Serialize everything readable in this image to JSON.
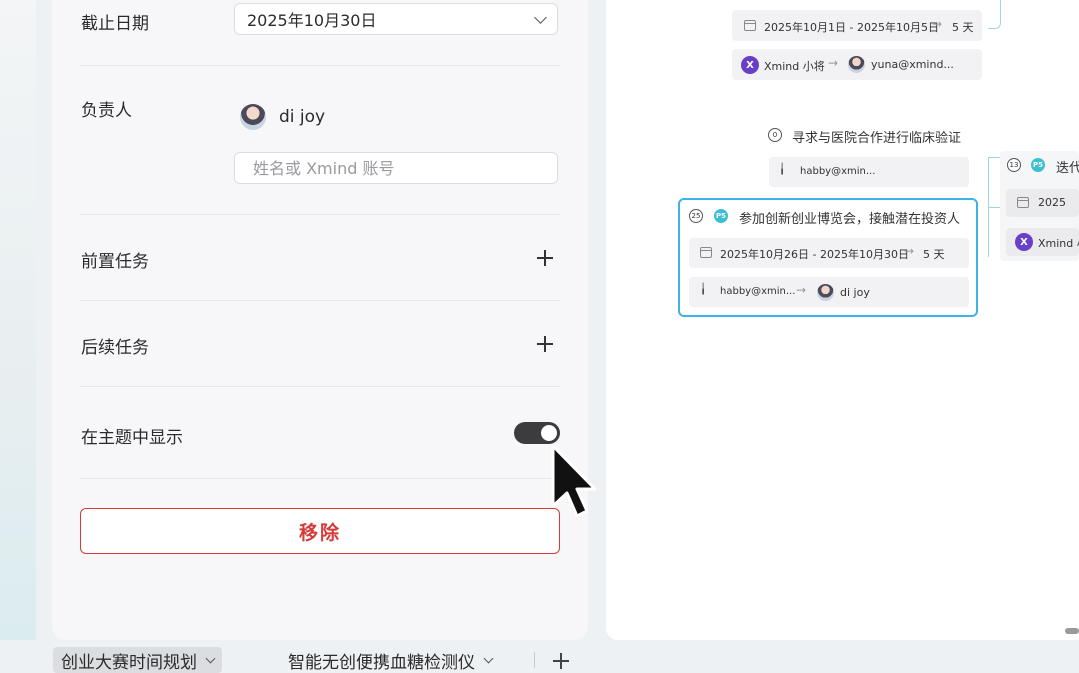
{
  "panel": {
    "due_date_label": "截止日期",
    "due_date_value": "2025年10月30日",
    "assignee_label": "负责人",
    "assignee_name": "di joy",
    "assignee_placeholder": "姓名或 Xmind 账号",
    "predecessor_label": "前置任务",
    "successor_label": "后续任务",
    "show_in_topic_label": "在主题中显示",
    "show_in_topic_on": true,
    "remove_label": "移除"
  },
  "canvas": {
    "top_node": {
      "date_range": "2025年10月1日 - 2025年10月5日",
      "duration": "5 天",
      "from_badge": "X",
      "from_user": "Xmind 小将",
      "to_user": "yuna@xmind..."
    },
    "middle_topic": {
      "progress": "0",
      "title": "寻求与医院合作进行临床验证",
      "user": "habby@xmin..."
    },
    "selected_topic": {
      "progress": "25",
      "priority": "P5",
      "title": "参加创新创业博览会，接触潜在投资人",
      "date_range": "2025年10月26日 - 2025年10月30日",
      "duration": "5 天",
      "from_user": "habby@xmin...",
      "to_user": "di joy"
    },
    "right_topic": {
      "progress": "13",
      "priority": "P5",
      "title_partial": "迭代",
      "date_partial": "2025",
      "badge": "X",
      "user_partial": "Xmind 小"
    }
  },
  "tabs": [
    {
      "label": "创业大赛时间规划",
      "active": true
    },
    {
      "label": "智能无创便携血糖检测仪",
      "active": false
    }
  ],
  "colors": {
    "accent_selected": "#3fb3e8",
    "danger": "#d53b3b",
    "priority": "#3dbfd2",
    "xmind_badge": "#6a3fc7"
  }
}
